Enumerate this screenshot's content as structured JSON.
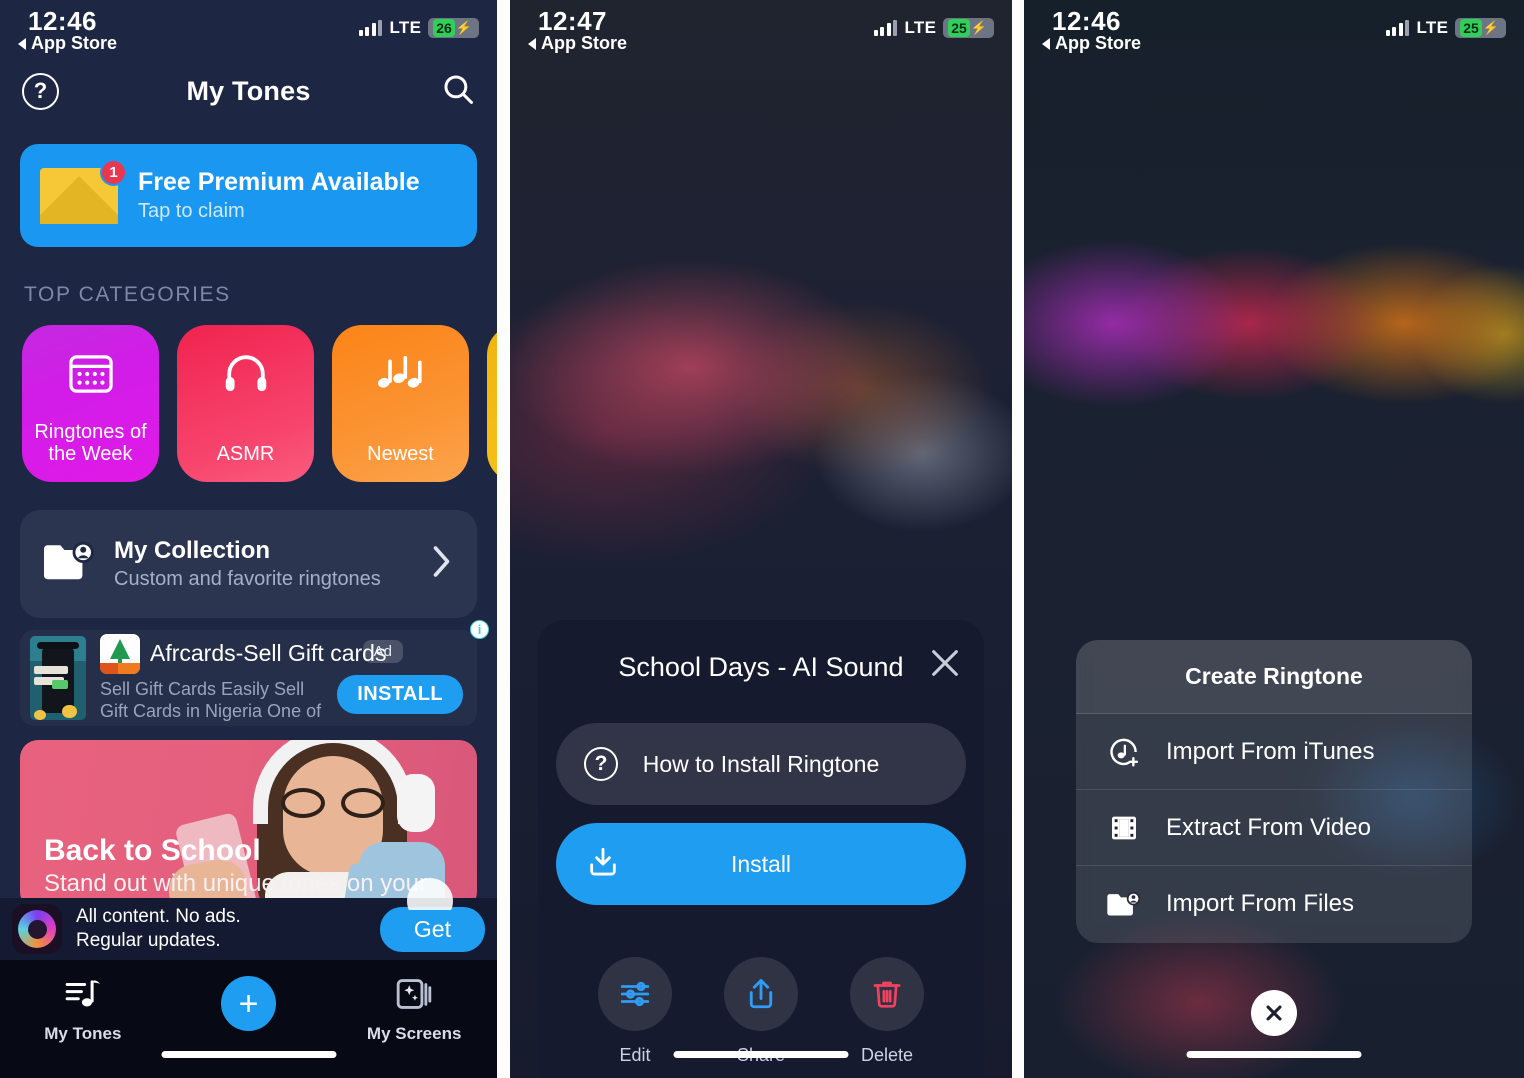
{
  "panel1": {
    "status": {
      "time": "12:46",
      "back_label": "App Store",
      "network": "LTE",
      "battery": "26"
    },
    "nav": {
      "help_icon": "question-circle-icon",
      "title": "My Tones",
      "search_icon": "search-icon"
    },
    "premium_banner": {
      "icon": "envelope-icon",
      "badge": "1",
      "title": "Free Premium Available",
      "subtitle": "Tap to claim"
    },
    "section_label": "TOP CATEGORIES",
    "categories": [
      {
        "name": "Ringtones of\nthe Week",
        "line1": "Ringtones of",
        "line2": "the Week",
        "icon": "calendar-icon",
        "color": "#d21ce8"
      },
      {
        "name": "ASMR",
        "line1": "ASMR",
        "line2": "",
        "icon": "headphones-icon",
        "color": "#f7456d"
      },
      {
        "name": "Newest",
        "line1": "Newest",
        "line2": "",
        "icon": "music-notes-icon",
        "color": "#fb9433"
      },
      {
        "name": "",
        "line1": "",
        "line2": "",
        "icon": "",
        "color": "#f6c41b"
      }
    ],
    "collection": {
      "icon": "folder-user-icon",
      "title": "My Collection",
      "subtitle": "Custom and favorite ringtones",
      "chevron": "chevron-right-icon"
    },
    "ad": {
      "title": "Afrcards-Sell Gift cards",
      "desc_line1": "Sell Gift Cards Easily Sell",
      "desc_line2": "Gift Cards in Nigeria One of",
      "badge": "Ad",
      "install_label": "INSTALL",
      "info_icon": "ad-info-icon"
    },
    "promo": {
      "title": "Back to School",
      "subtitle": "Stand out with unique tones on your"
    },
    "ad_strip": {
      "line1": "All content. No ads.",
      "line2": "Regular updates.",
      "button_label": "Get"
    },
    "tabs": [
      {
        "label": "My Tones",
        "icon": "music-list-icon"
      },
      {
        "label": "",
        "icon": "plus-icon"
      },
      {
        "label": "My Screens",
        "icon": "sparkle-screens-icon"
      }
    ]
  },
  "panel2": {
    "status": {
      "time": "12:47",
      "back_label": "App Store",
      "network": "LTE",
      "battery": "25"
    },
    "sheet": {
      "title": "School Days - AI Sound",
      "close_icon": "close-icon",
      "howto_label": "How to Install Ringtone",
      "howto_icon": "question-circle-icon",
      "install_label": "Install",
      "install_icon": "download-icon"
    },
    "actions": [
      {
        "label": "Edit",
        "icon": "sliders-icon",
        "color": "#2f9cf5"
      },
      {
        "label": "Share",
        "icon": "share-icon",
        "color": "#2f9cf5"
      },
      {
        "label": "Delete",
        "icon": "trash-icon",
        "color": "#f2425f"
      }
    ]
  },
  "panel3": {
    "status": {
      "time": "12:46",
      "back_label": "App Store",
      "network": "LTE",
      "battery": "25"
    },
    "sheet": {
      "title": "Create Ringtone",
      "items": [
        {
          "label": "Import From iTunes",
          "icon": "music-add-icon"
        },
        {
          "label": "Extract From Video",
          "icon": "film-icon"
        },
        {
          "label": "Import From Files",
          "icon": "folder-user-icon"
        }
      ],
      "close_icon": "close-icon"
    }
  },
  "colors": {
    "accent_blue": "#1f9df0",
    "badge_red": "#e8384f",
    "delete_red": "#f2425f",
    "battery_green": "#2fd05a"
  }
}
